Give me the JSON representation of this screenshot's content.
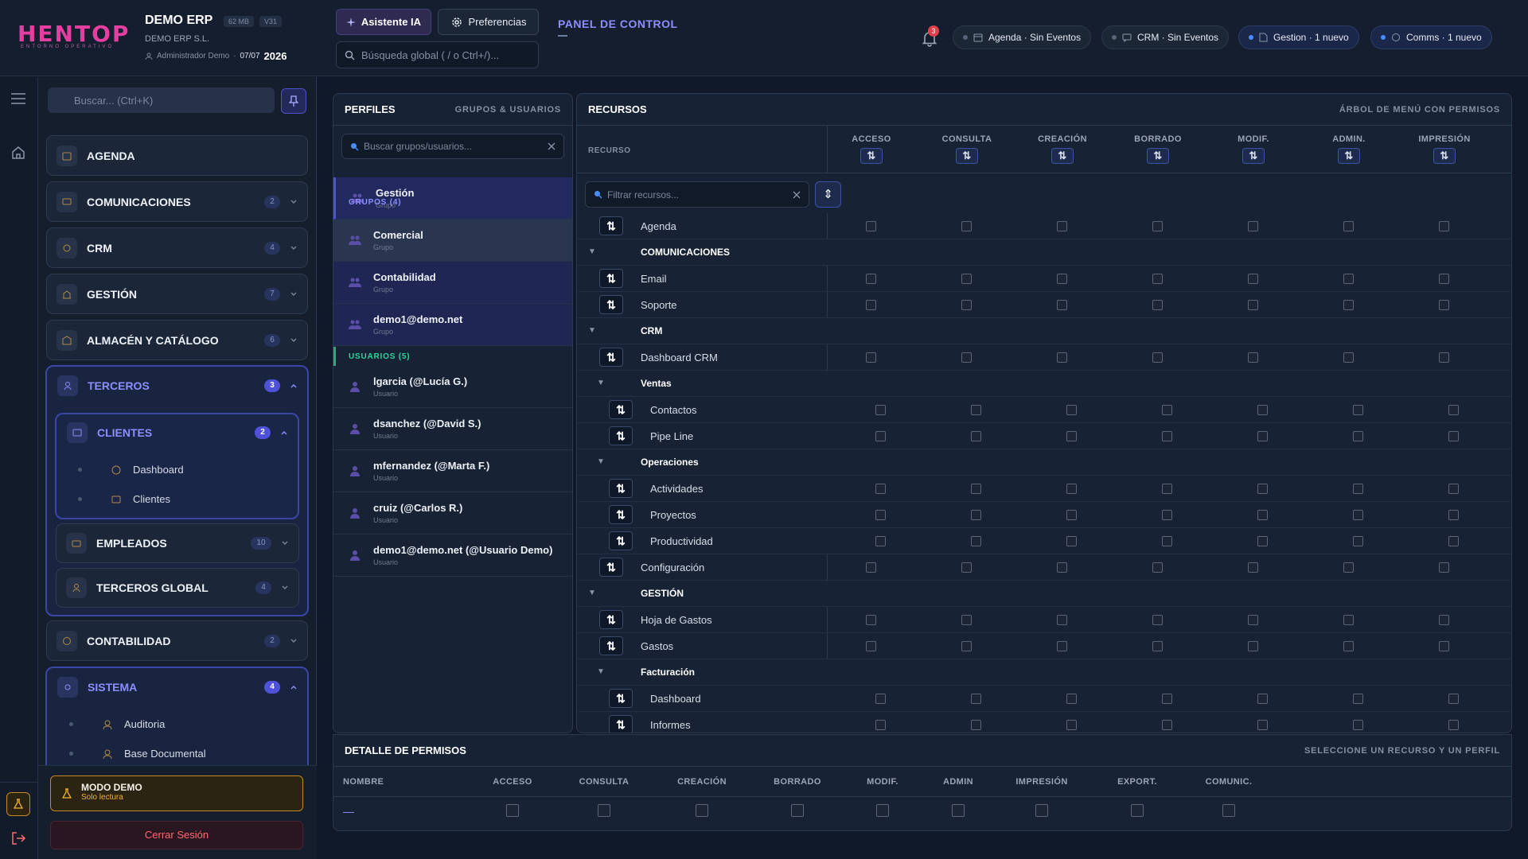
{
  "header": {
    "logo_text": "HENTOP",
    "logo_sub": "ENTORNO OPERATIVO",
    "app_name": "DEMO ERP",
    "size_chip": "62 MB",
    "version_chip": "V31",
    "company": "DEMO ERP S.L.",
    "user": "Administrador Demo",
    "date": "07/07",
    "year": "2026",
    "ai_button": "Asistente IA",
    "prefs_button": "Preferencias",
    "search_placeholder": "Búsqueda global ( / o Ctrl+/)...",
    "panel_title": "PANEL DE CONTROL",
    "bell_count": "3",
    "pills": [
      {
        "label": "Agenda · Sin Eventos",
        "icon": "calendar-icon",
        "active": false
      },
      {
        "label": "CRM · Sin Eventos",
        "icon": "chat-icon",
        "active": false
      },
      {
        "label": "Gestion · 1 nuevo",
        "icon": "document-icon",
        "active": true
      },
      {
        "label": "Comms · 1 nuevo",
        "icon": "message-icon",
        "active": true
      }
    ]
  },
  "sidebar": {
    "search_placeholder": "Buscar... (Ctrl+K)",
    "items": [
      {
        "label": "AGENDA",
        "count": ""
      },
      {
        "label": "COMUNICACIONES",
        "count": "2"
      },
      {
        "label": "CRM",
        "count": "4"
      },
      {
        "label": "GESTIÓN",
        "count": "7"
      },
      {
        "label": "ALMACÉN Y CATÁLOGO",
        "count": "6"
      },
      {
        "label": "TERCEROS",
        "count": "3"
      },
      {
        "label": "CONTABILIDAD",
        "count": "2"
      },
      {
        "label": "SISTEMA",
        "count": "4"
      }
    ],
    "terceros_sub": [
      {
        "label": "CLIENTES",
        "count": "2"
      },
      {
        "label": "EMPLEADOS",
        "count": "10"
      },
      {
        "label": "TERCEROS GLOBAL",
        "count": "4"
      }
    ],
    "clientes_leaves": [
      "Dashboard",
      "Clientes"
    ],
    "sistema_leaves": [
      "Auditoria",
      "Base Documental"
    ],
    "demo_title": "MODO DEMO",
    "demo_sub": "Solo lectura",
    "logout": "Cerrar Sesión"
  },
  "perfiles": {
    "title": "PERFILES",
    "subtitle": "GRUPOS & USUARIOS",
    "search_placeholder": "Buscar grupos/usuarios...",
    "groups_header": "GRUPOS (4)",
    "groups": [
      {
        "name": "Gestión",
        "type": "Grupo"
      },
      {
        "name": "Comercial",
        "type": "Grupo"
      },
      {
        "name": "Contabilidad",
        "type": "Grupo"
      },
      {
        "name": "demo1@demo.net",
        "type": "Grupo"
      }
    ],
    "users_header": "USUARIOS (5)",
    "users": [
      {
        "name": "lgarcia (@Lucía G.)",
        "type": "Usuario"
      },
      {
        "name": "dsanchez (@David S.)",
        "type": "Usuario"
      },
      {
        "name": "mfernandez (@Marta F.)",
        "type": "Usuario"
      },
      {
        "name": "cruiz (@Carlos R.)",
        "type": "Usuario"
      },
      {
        "name": "demo1@demo.net (@Usuario Demo)",
        "type": "Usuario"
      }
    ]
  },
  "recursos": {
    "title": "RECURSOS",
    "subtitle": "ÁRBOL DE MENÚ CON PERMISOS",
    "col_label": "RECURSO",
    "columns": [
      "ACCESO",
      "CONSULTA",
      "CREACIÓN",
      "BORRADO",
      "MODIF.",
      "ADMIN.",
      "IMPRESIÓN"
    ],
    "filter_placeholder": "Filtrar recursos...",
    "rows": [
      {
        "kind": "item",
        "level": 0,
        "name": "Agenda"
      },
      {
        "kind": "group",
        "level": 0,
        "name": "COMUNICACIONES"
      },
      {
        "kind": "item",
        "level": 0,
        "name": "Email"
      },
      {
        "kind": "item",
        "level": 0,
        "name": "Soporte"
      },
      {
        "kind": "group",
        "level": 0,
        "name": "CRM"
      },
      {
        "kind": "item",
        "level": 0,
        "name": "Dashboard CRM"
      },
      {
        "kind": "group",
        "level": 1,
        "name": "Ventas"
      },
      {
        "kind": "item",
        "level": 1,
        "name": "Contactos"
      },
      {
        "kind": "item",
        "level": 1,
        "name": "Pipe Line"
      },
      {
        "kind": "group",
        "level": 1,
        "name": "Operaciones"
      },
      {
        "kind": "item",
        "level": 1,
        "name": "Actividades"
      },
      {
        "kind": "item",
        "level": 1,
        "name": "Proyectos"
      },
      {
        "kind": "item",
        "level": 1,
        "name": "Productividad"
      },
      {
        "kind": "item",
        "level": 0,
        "name": "Configuración"
      },
      {
        "kind": "group",
        "level": 0,
        "name": "GESTIÓN"
      },
      {
        "kind": "item",
        "level": 0,
        "name": "Hoja de Gastos"
      },
      {
        "kind": "item",
        "level": 0,
        "name": "Gastos"
      },
      {
        "kind": "group",
        "level": 1,
        "name": "Facturación"
      },
      {
        "kind": "item",
        "level": 1,
        "name": "Dashboard"
      },
      {
        "kind": "item",
        "level": 1,
        "name": "Informes"
      }
    ]
  },
  "detalle": {
    "title": "DETALLE DE PERMISOS",
    "hint": "SELECCIONE UN RECURSO Y UN PERFIL",
    "columns": [
      "NOMBRE",
      "ACCESO",
      "CONSULTA",
      "CREACIÓN",
      "BORRADO",
      "MODIF.",
      "ADMIN",
      "IMPRESIÓN",
      "EXPORT.",
      "COMUNIC."
    ],
    "row_name": "—"
  }
}
